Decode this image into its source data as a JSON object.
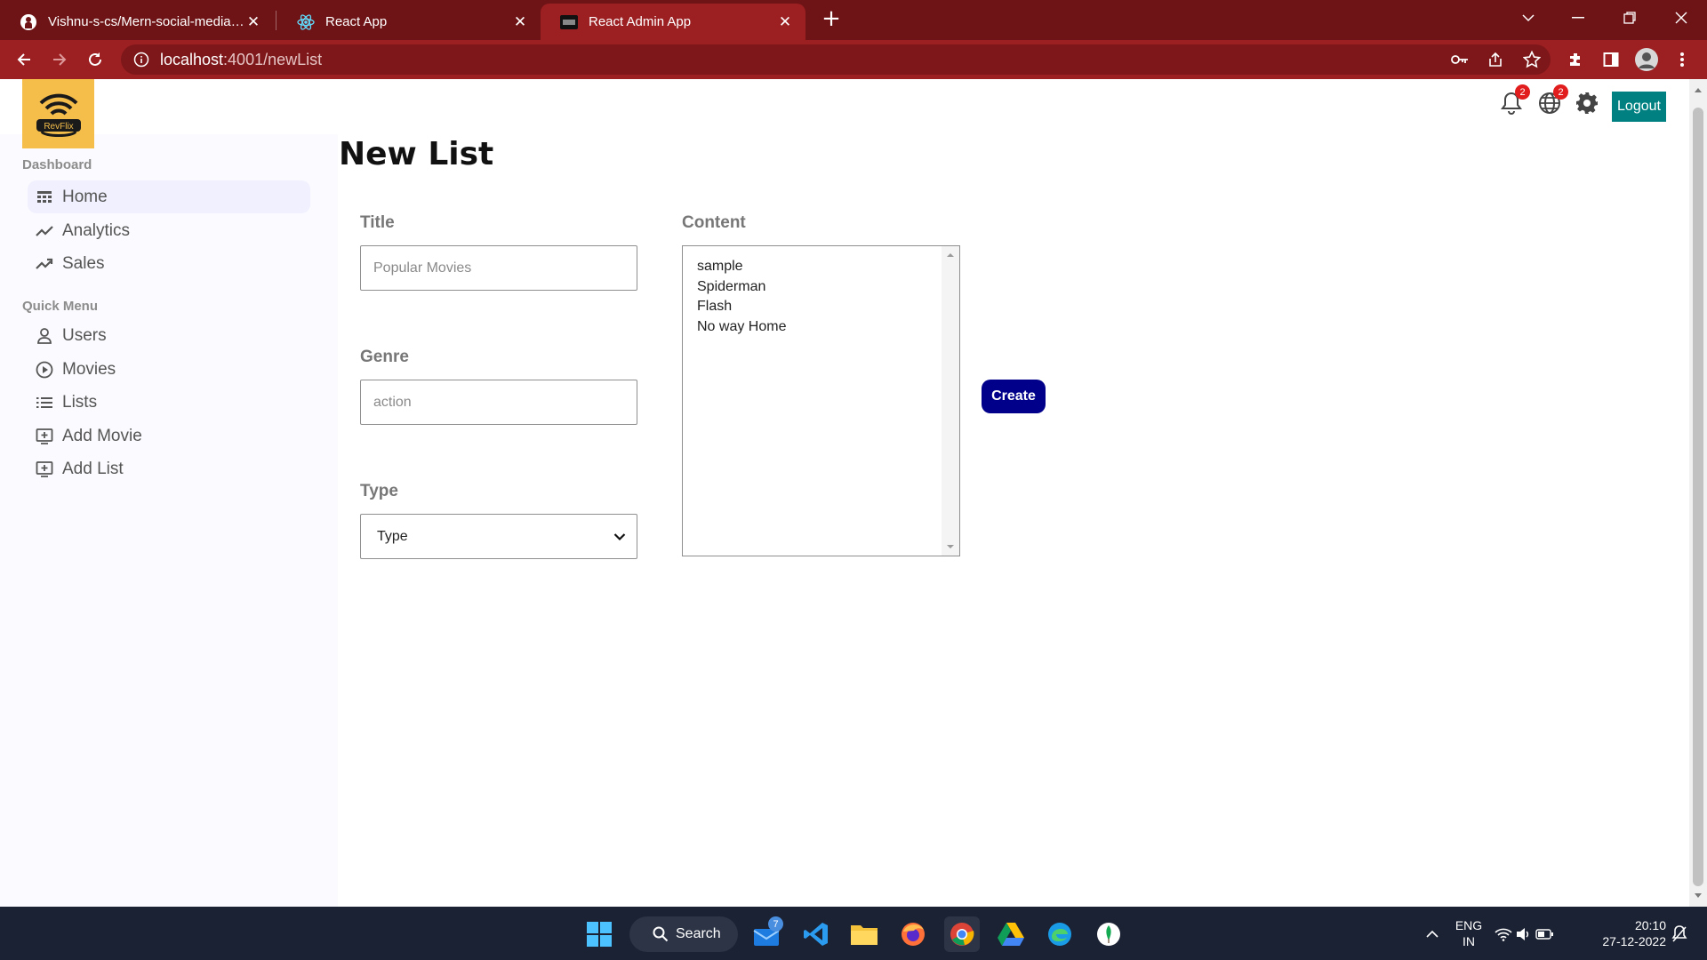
{
  "browser": {
    "tabs": [
      {
        "title": "Vishnu-s-cs/Mern-social-media-app",
        "icon": "github-icon"
      },
      {
        "title": "React App",
        "icon": "react-icon"
      },
      {
        "title": "React Admin App",
        "icon": "app-icon",
        "active": true
      }
    ],
    "url_host": "localhost",
    "url_path": ":4001/newList"
  },
  "app": {
    "logo_text": "RevFlix",
    "sidebar": {
      "sections": [
        {
          "title": "Dashboard",
          "items": [
            {
              "label": "Home",
              "icon": "home-icon",
              "active": true
            },
            {
              "label": "Analytics",
              "icon": "trending-icon"
            },
            {
              "label": "Sales",
              "icon": "trending-icon"
            }
          ]
        },
        {
          "title": "Quick Menu",
          "items": [
            {
              "label": "Users",
              "icon": "user-icon"
            },
            {
              "label": "Movies",
              "icon": "play-circle-icon"
            },
            {
              "label": "Lists",
              "icon": "list-icon"
            },
            {
              "label": "Add Movie",
              "icon": "add-box-icon"
            },
            {
              "label": "Add List",
              "icon": "add-box-icon"
            }
          ]
        }
      ]
    },
    "topbar": {
      "notification_count": "2",
      "language_count": "2",
      "logout_label": "Logout"
    },
    "form": {
      "heading": "New List",
      "title_label": "Title",
      "title_placeholder": "Popular Movies",
      "genre_label": "Genre",
      "genre_placeholder": "action",
      "type_label": "Type",
      "type_selected": "Type",
      "content_label": "Content",
      "content_options": [
        "sample",
        "Spiderman",
        "Flash",
        "No way Home"
      ],
      "create_label": "Create"
    }
  },
  "taskbar": {
    "search_label": "Search",
    "mail_badge": "7",
    "language": "ENG",
    "region": "IN",
    "time": "20:10",
    "date": "27-12-2022"
  },
  "colors": {
    "titlebar": "#6f1416",
    "toolbar": "#9c1f22",
    "logout": "#008080",
    "create": "#00008b",
    "logo_bg": "#f5be4a",
    "taskbar": "#1b2233"
  }
}
